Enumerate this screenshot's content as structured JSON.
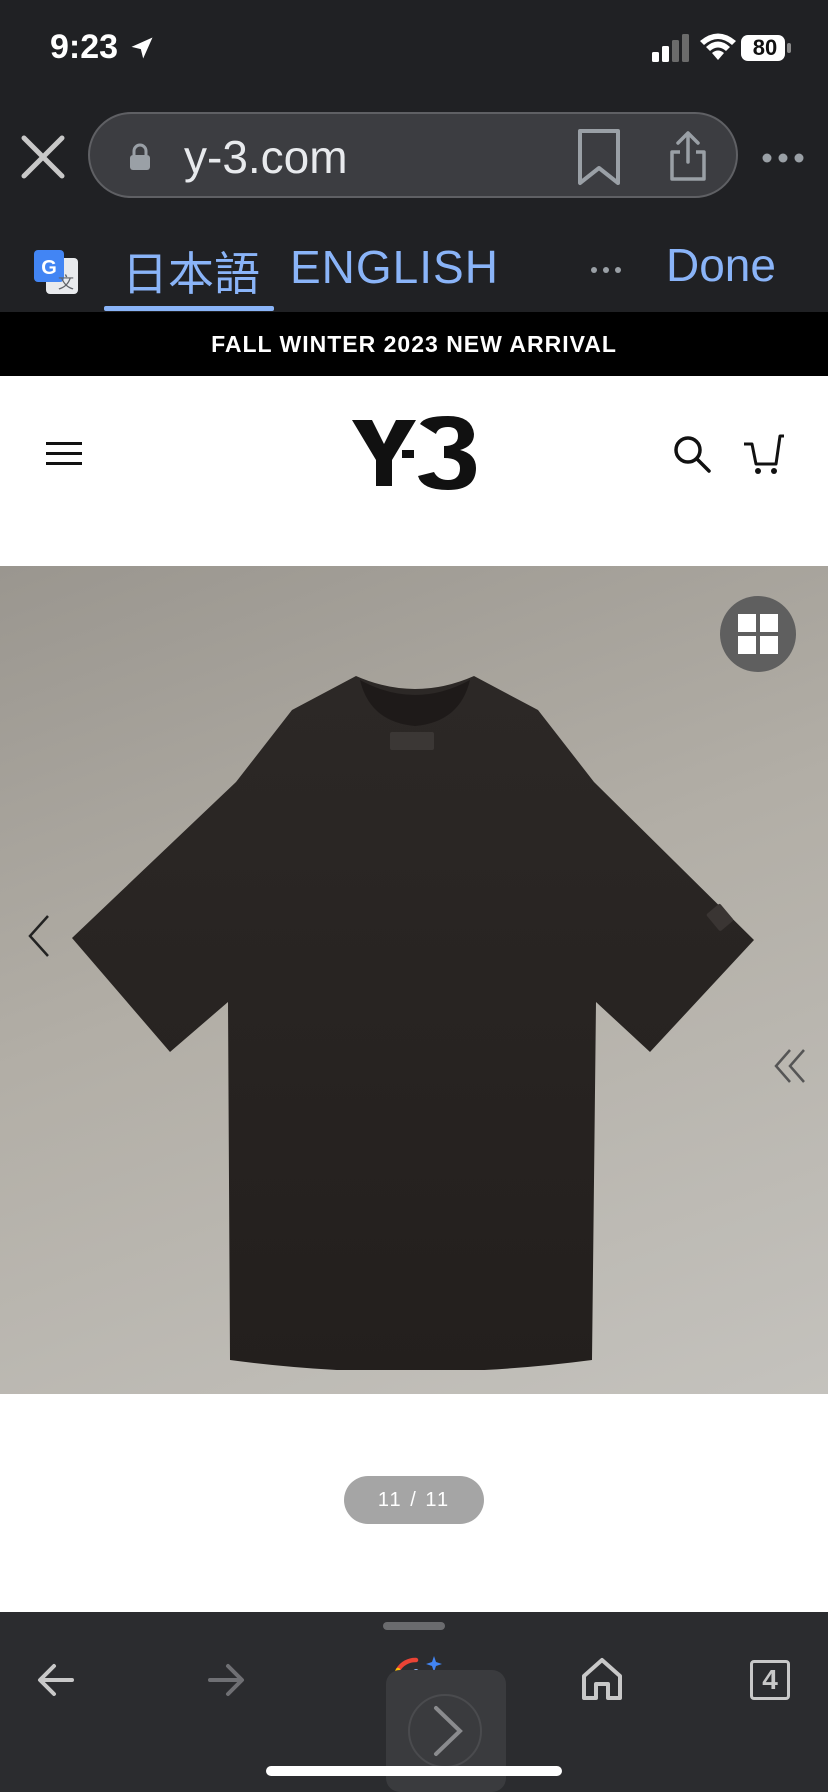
{
  "status_bar": {
    "time": "9:23",
    "battery": "80"
  },
  "browser": {
    "url": "y-3.com",
    "translate": {
      "lang_original": "日本語",
      "lang_target": "ENGLISH",
      "done_label": "Done"
    }
  },
  "site": {
    "promo_text": "FALL WINTER 2023 NEW ARRIVAL",
    "logo_text": "Y-3",
    "gallery": {
      "counter": "11 / 11"
    }
  },
  "toolbar": {
    "tab_count": "4"
  },
  "colors": {
    "chrome_bg": "#202124",
    "accent_blue": "#8ab4f8",
    "promo_bg": "#000000",
    "toolbar_bg": "#2b2c2f"
  },
  "icons": [
    "location-arrow-icon",
    "signal-icon",
    "wifi-icon",
    "battery-icon",
    "close-icon",
    "lock-icon",
    "bookmark-icon",
    "share-icon",
    "more-icon",
    "google-translate-icon",
    "menu-icon",
    "search-icon",
    "cart-icon",
    "grid-icon",
    "chevron-left-icon",
    "double-chevron-left-icon",
    "back-icon",
    "forward-icon",
    "google-lens-icon",
    "home-icon",
    "tabs-icon"
  ]
}
